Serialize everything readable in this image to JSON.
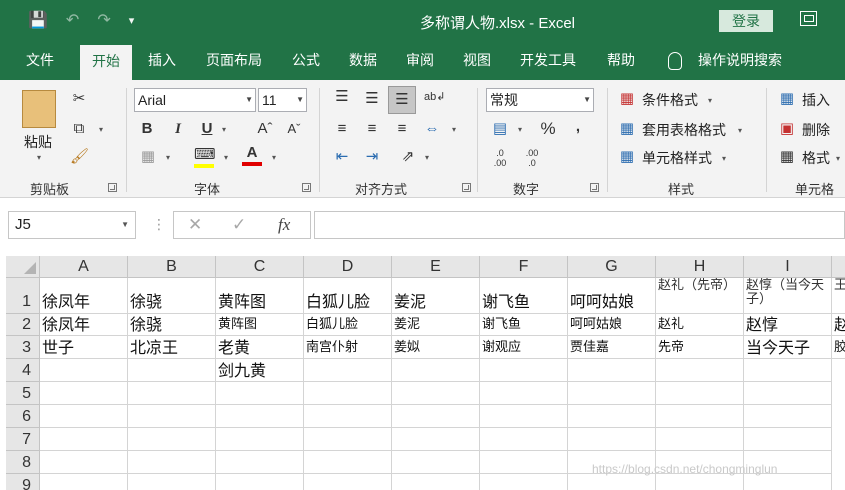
{
  "titlebar": {
    "title": "多称谓人物.xlsx  -  Excel",
    "login_label": "登录"
  },
  "tabs": [
    {
      "label": "文件"
    },
    {
      "label": "开始"
    },
    {
      "label": "插入"
    },
    {
      "label": "页面布局"
    },
    {
      "label": "公式"
    },
    {
      "label": "数据"
    },
    {
      "label": "审阅"
    },
    {
      "label": "视图"
    },
    {
      "label": "开发工具"
    },
    {
      "label": "帮助"
    }
  ],
  "tell_me": "操作说明搜索",
  "ribbon": {
    "paste_label": "粘贴",
    "font_name": "Arial",
    "font_size": "11",
    "number_format": "常规",
    "conditional_format": "条件格式",
    "table_format": "套用表格格式",
    "cell_style": "单元格样式",
    "insert_label": "插入",
    "delete_label": "删除",
    "format_label": "格式",
    "groups": {
      "clipboard": "剪贴板",
      "font": "字体",
      "alignment": "对齐方式",
      "number": "数字",
      "styles": "样式",
      "cells": "单元格"
    }
  },
  "formula_bar": {
    "name_box": "J5",
    "fx": "fx",
    "formula": ""
  },
  "sheet": {
    "columns": [
      "A",
      "B",
      "C",
      "D",
      "E",
      "F",
      "G",
      "H",
      "I"
    ],
    "rows": [
      "1",
      "2",
      "3",
      "4",
      "5",
      "6",
      "7",
      "8",
      "9"
    ],
    "cells": {
      "A1": "徐凤年",
      "B1": "徐骁",
      "C1": "黄阵图",
      "D1": "白狐儿脸",
      "E1": "姜泥",
      "F1": "谢飞鱼",
      "G1": "呵呵姑娘",
      "H1": "赵礼（先帝）",
      "I1": "赵惇（当今天子）",
      "J1": "王",
      "A2": "徐凤年",
      "B2": "徐骁",
      "C2": "黄阵图",
      "D2": "白狐儿脸",
      "E2": "姜泥",
      "F2": "谢飞鱼",
      "G2": "呵呵姑娘",
      "H2": "赵礼",
      "I2": "赵惇",
      "J2": "赵",
      "A3": "世子",
      "B3": "北凉王",
      "C3": "老黄",
      "D3": "南宫仆射",
      "E3": "姜姒",
      "F3": "谢观应",
      "G3": "贾佳嘉",
      "H3": "先帝",
      "I3": "当今天子",
      "J3": "胶",
      "C4": "剑九黄"
    }
  },
  "watermark": "https://blog.csdn.net/chongminglun"
}
